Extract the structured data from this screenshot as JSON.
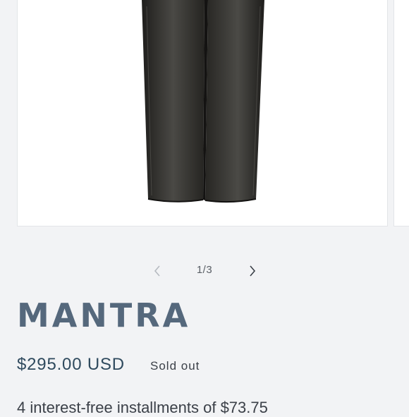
{
  "product": {
    "title": "MANTRA",
    "price": "$295.00 USD",
    "badge": "Sold out",
    "installments": "4 interest-free installments of $73.75"
  },
  "gallery": {
    "counter": "1/3",
    "current": 1,
    "total": 3,
    "image_icon": "black-denim-jeans-image",
    "prev_icon": "chevron-left-icon",
    "next_icon": "chevron-right-icon"
  },
  "colors": {
    "background": "#f2f3f5",
    "title": "#55687c",
    "price": "#2f4a5e",
    "denim": "#2b2a28"
  }
}
